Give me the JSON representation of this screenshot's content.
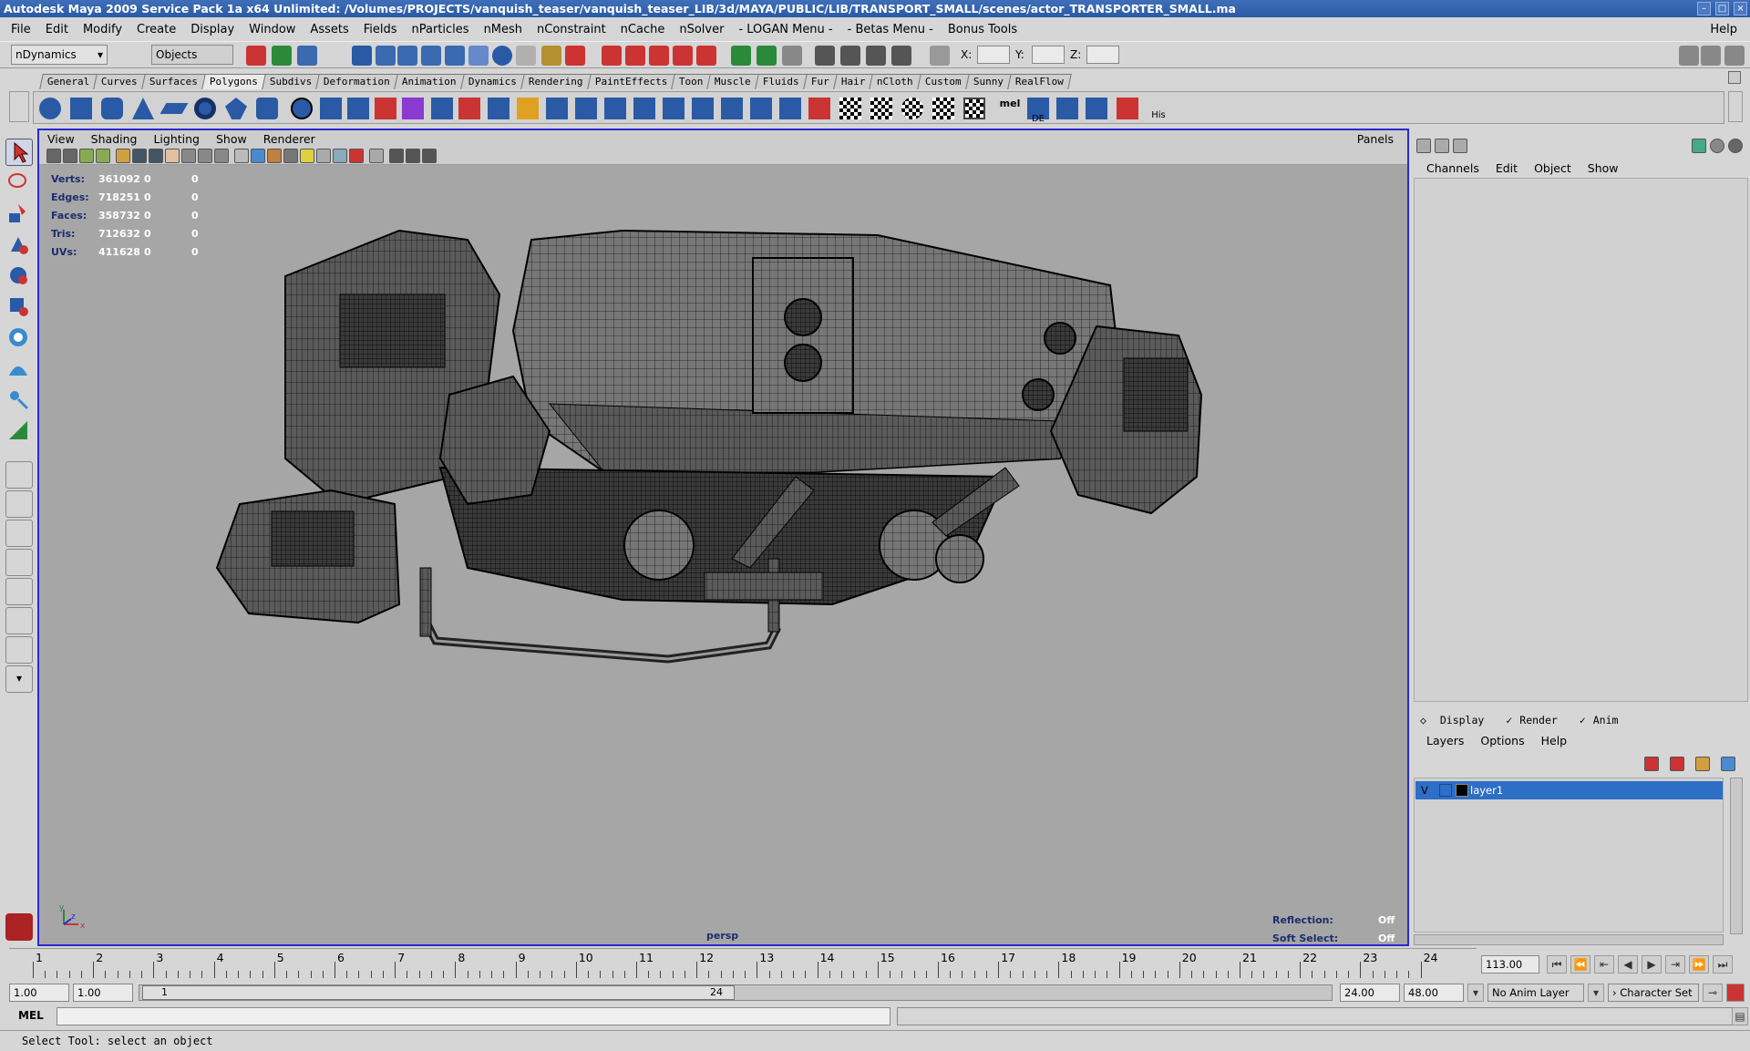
{
  "window": {
    "title": "Autodesk Maya 2009 Service Pack 1a x64 Unlimited: /Volumes/PROJECTS/vanquish_teaser/vanquish_teaser_LIB/3d/MAYA/PUBLIC/LIB/TRANSPORT_SMALL/scenes/actor_TRANSPORTER_SMALL.ma"
  },
  "menubar": {
    "items": [
      "File",
      "Edit",
      "Modify",
      "Create",
      "Display",
      "Window",
      "Assets",
      "Fields",
      "nParticles",
      "nMesh",
      "nConstraint",
      "nCache",
      "nSolver",
      "- LOGAN Menu -",
      "- Betas Menu -",
      "Bonus Tools"
    ],
    "help": "Help"
  },
  "statusline": {
    "menuset": "nDynamics",
    "selection_mode": "Objects",
    "x_label": "X:",
    "y_label": "Y:",
    "z_label": "Z:"
  },
  "shelf": {
    "tabs": [
      "General",
      "Curves",
      "Surfaces",
      "Polygons",
      "Subdivs",
      "Deformation",
      "Animation",
      "Dynamics",
      "Rendering",
      "PaintEffects",
      "Toon",
      "Muscle",
      "Fluids",
      "Fur",
      "Hair",
      "nCloth",
      "Custom",
      "Sunny",
      "RealFlow"
    ],
    "active": "Polygons",
    "text_icons": [
      "mel",
      "DE",
      "His"
    ]
  },
  "viewport": {
    "menu": [
      "View",
      "Shading",
      "Lighting",
      "Show",
      "Renderer"
    ],
    "panels": "Panels",
    "camera": "persp",
    "hud": [
      {
        "label": "Verts:",
        "value": "361092",
        "a": "0",
        "b": "0"
      },
      {
        "label": "Edges:",
        "value": "718251",
        "a": "0",
        "b": "0"
      },
      {
        "label": "Faces:",
        "value": "358732",
        "a": "0",
        "b": "0"
      },
      {
        "label": "Tris:",
        "value": "712632",
        "a": "0",
        "b": "0"
      },
      {
        "label": "UVs:",
        "value": "411628",
        "a": "0",
        "b": "0"
      }
    ],
    "reflection_label": "Reflection:",
    "reflection_value": "Off",
    "softselect_label": "Soft Select:",
    "softselect_value": "Off",
    "axis": {
      "x": "x",
      "y": "y",
      "z": "z"
    }
  },
  "channel_box": {
    "menu": [
      "Channels",
      "Edit",
      "Object",
      "Show"
    ]
  },
  "layer_editor": {
    "tabs": [
      "Display",
      "Render",
      "Anim"
    ],
    "menu": [
      "Layers",
      "Options",
      "Help"
    ],
    "layers": [
      {
        "visible": "V",
        "name": "layer1"
      }
    ]
  },
  "timeline": {
    "ticks": [
      "1",
      "2",
      "3",
      "4",
      "5",
      "6",
      "7",
      "8",
      "9",
      "10",
      "11",
      "12",
      "13",
      "14",
      "15",
      "16",
      "17",
      "18",
      "19",
      "20",
      "21",
      "22",
      "23",
      "24"
    ],
    "current_frame": "113.00"
  },
  "range": {
    "start": "1.00",
    "playback_start": "1.00",
    "handle_start": "1",
    "handle_end": "24",
    "playback_end": "24.00",
    "end": "48.00",
    "anim_layer": "No Anim Layer",
    "character_set": "Character Set"
  },
  "command": {
    "label": "MEL"
  },
  "status": {
    "help_text": "Select Tool: select an object"
  },
  "colors": {
    "title_bar": "#2a5aa6",
    "viewport_bg": "#a6a6a6",
    "active_frame": "#2a2ad0",
    "selection": "#2d6ec7"
  }
}
